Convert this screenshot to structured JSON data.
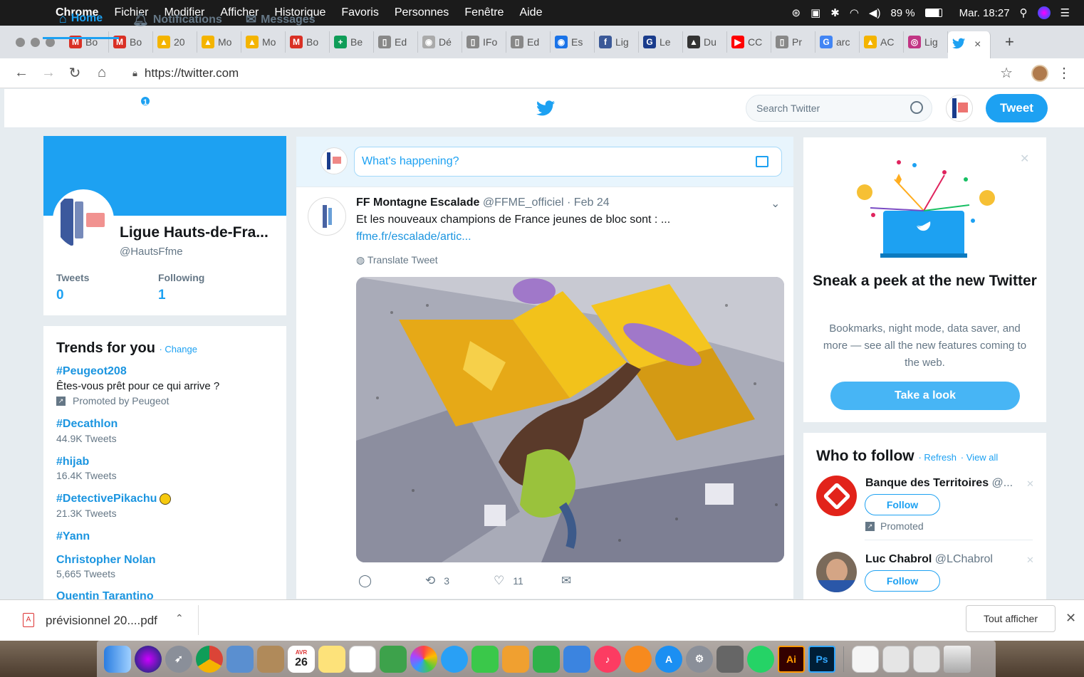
{
  "menubar": {
    "app": "Chrome",
    "items": [
      "Fichier",
      "Modifier",
      "Afficher",
      "Historique",
      "Favoris",
      "Personnes",
      "Fenêtre",
      "Aide"
    ],
    "battery": "89 %",
    "clock": "Mar. 18:27"
  },
  "tabs": [
    {
      "label": "Bo",
      "icon": "M",
      "color": "#d93025"
    },
    {
      "label": "Bo",
      "icon": "M",
      "color": "#d93025"
    },
    {
      "label": "20",
      "icon": "▲",
      "color": "#f4b400"
    },
    {
      "label": "Mo",
      "icon": "▲",
      "color": "#f4b400"
    },
    {
      "label": "Mo",
      "icon": "▲",
      "color": "#f4b400"
    },
    {
      "label": "Bo",
      "icon": "M",
      "color": "#d93025"
    },
    {
      "label": "Be",
      "icon": "+",
      "color": "#0f9d58"
    },
    {
      "label": "Ed",
      "icon": "▯",
      "color": "#888888"
    },
    {
      "label": "Dé",
      "icon": "◉",
      "color": "#aaaaaa"
    },
    {
      "label": "IFo",
      "icon": "▯",
      "color": "#888888"
    },
    {
      "label": "Ed",
      "icon": "▯",
      "color": "#888888"
    },
    {
      "label": "Es",
      "icon": "◉",
      "color": "#1a73e8"
    },
    {
      "label": "Lig",
      "icon": "f",
      "color": "#3b5998"
    },
    {
      "label": "Le",
      "icon": "G",
      "color": "#1a3c8c"
    },
    {
      "label": "Du",
      "icon": "▲",
      "color": "#333333"
    },
    {
      "label": "CC",
      "icon": "▶",
      "color": "#ff0000"
    },
    {
      "label": "Pr",
      "icon": "▯",
      "color": "#888888"
    },
    {
      "label": "arc",
      "icon": "G",
      "color": "#4285f4"
    },
    {
      "label": "AC",
      "icon": "▲",
      "color": "#f4b400"
    },
    {
      "label": "Lig",
      "icon": "◎",
      "color": "#c13584"
    }
  ],
  "active_tab": {
    "icon": "twitter-bird",
    "close": "×"
  },
  "newtab": "+",
  "address": {
    "url": "https://twitter.com"
  },
  "twitter": {
    "nav": {
      "home": "Home",
      "notifications": "Notifications",
      "notif_count": "1",
      "messages": "Messages"
    },
    "search_placeholder": "Search Twitter",
    "tweet_button": "Tweet",
    "profile": {
      "name": "Ligue Hauts-de-Fra...",
      "handle": "@HautsFfme",
      "tweets_label": "Tweets",
      "tweets_value": "0",
      "following_label": "Following",
      "following_value": "1"
    },
    "trends": {
      "title": "Trends for you",
      "change": "Change",
      "items": [
        {
          "name": "#Peugeot208",
          "desc": "Êtes-vous prêt pour ce qui arrive ?",
          "promoted": "Promoted by Peugeot"
        },
        {
          "name": "#Decathlon",
          "count": "44.9K Tweets"
        },
        {
          "name": "#hijab",
          "count": "16.4K Tweets"
        },
        {
          "name": "#DetectivePikachu",
          "count": "21.3K Tweets"
        },
        {
          "name": "#Yann"
        },
        {
          "name": "Christopher Nolan",
          "count": "5,665 Tweets"
        },
        {
          "name": "Quentin Tarantino"
        }
      ]
    },
    "compose": {
      "placeholder": "What's happening?"
    },
    "tweet": {
      "author": "FF Montagne Escalade",
      "handle": "@FFME_officiel",
      "date": "· Feb 24",
      "text": "Et les nouveaux champions de France jeunes de bloc sont : ...",
      "link": "ffme.fr/escalade/artic...",
      "translate": "Translate Tweet",
      "retweets": "3",
      "likes": "11"
    },
    "promo": {
      "title": "Sneak a peek at the new Twitter",
      "body": "Bookmarks, night mode, data saver, and more — see all the new features coming to the web.",
      "button": "Take a look"
    },
    "who_to_follow": {
      "title": "Who to follow",
      "refresh": "Refresh",
      "view_all": "View all",
      "items": [
        {
          "name": "Banque des Territoires",
          "handle": "@...",
          "follow": "Follow",
          "promoted": "Promoted"
        },
        {
          "name": "Luc Chabrol",
          "handle": "@LChabrol",
          "follow": "Follow"
        }
      ]
    }
  },
  "download": {
    "filename": "prévisionnel 20....pdf",
    "show_all": "Tout afficher"
  },
  "dock": {
    "calendar_day": "26",
    "calendar_month": "AVR",
    "ai": "Ai",
    "ps": "Ps"
  },
  "colors": {
    "twitter_blue": "#1da1f2",
    "link_blue": "#1b95e0",
    "gray_text": "#657786"
  }
}
